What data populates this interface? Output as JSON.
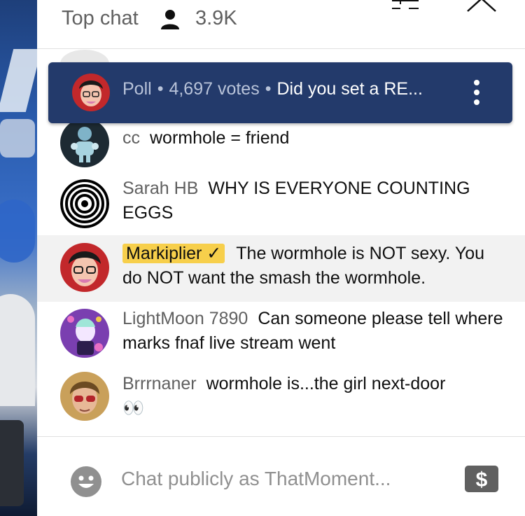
{
  "header": {
    "title": "Top chat",
    "viewer_count": "3.9K",
    "icons": {
      "viewers": "person-icon",
      "filter": "filter-icon",
      "collapse": "chevron-up-icon"
    }
  },
  "poll": {
    "label": "Poll",
    "votes": "4,697 votes",
    "question": "Did you set a RE...",
    "icons": {
      "menu": "more-vert-icon"
    },
    "colors": {
      "background": "#233a6b"
    }
  },
  "messages": [
    {
      "author": "cc",
      "text": "wormhole = friend"
    },
    {
      "author": "Sarah HB",
      "text": "WHY IS EVERYONE COUNTING EGGS"
    },
    {
      "author": "Markiplier",
      "verified": true,
      "text": "The wormhole is NOT sexy. You do NOT want the smash the wormhole."
    },
    {
      "author": "LightMoon 7890",
      "text": "Can someone please tell where marks fnaf live stream went"
    },
    {
      "author": "Brrrnaner",
      "text": "wormhole is...the girl next-door",
      "emoji": "👀"
    }
  ],
  "input": {
    "placeholder": "Chat publicly as ThatMoment...",
    "icons": {
      "emoji": "smiley-icon",
      "donate": "dollar-icon"
    }
  },
  "colors": {
    "owner_badge": "#f7cf4b",
    "secondary_text": "#606060"
  }
}
